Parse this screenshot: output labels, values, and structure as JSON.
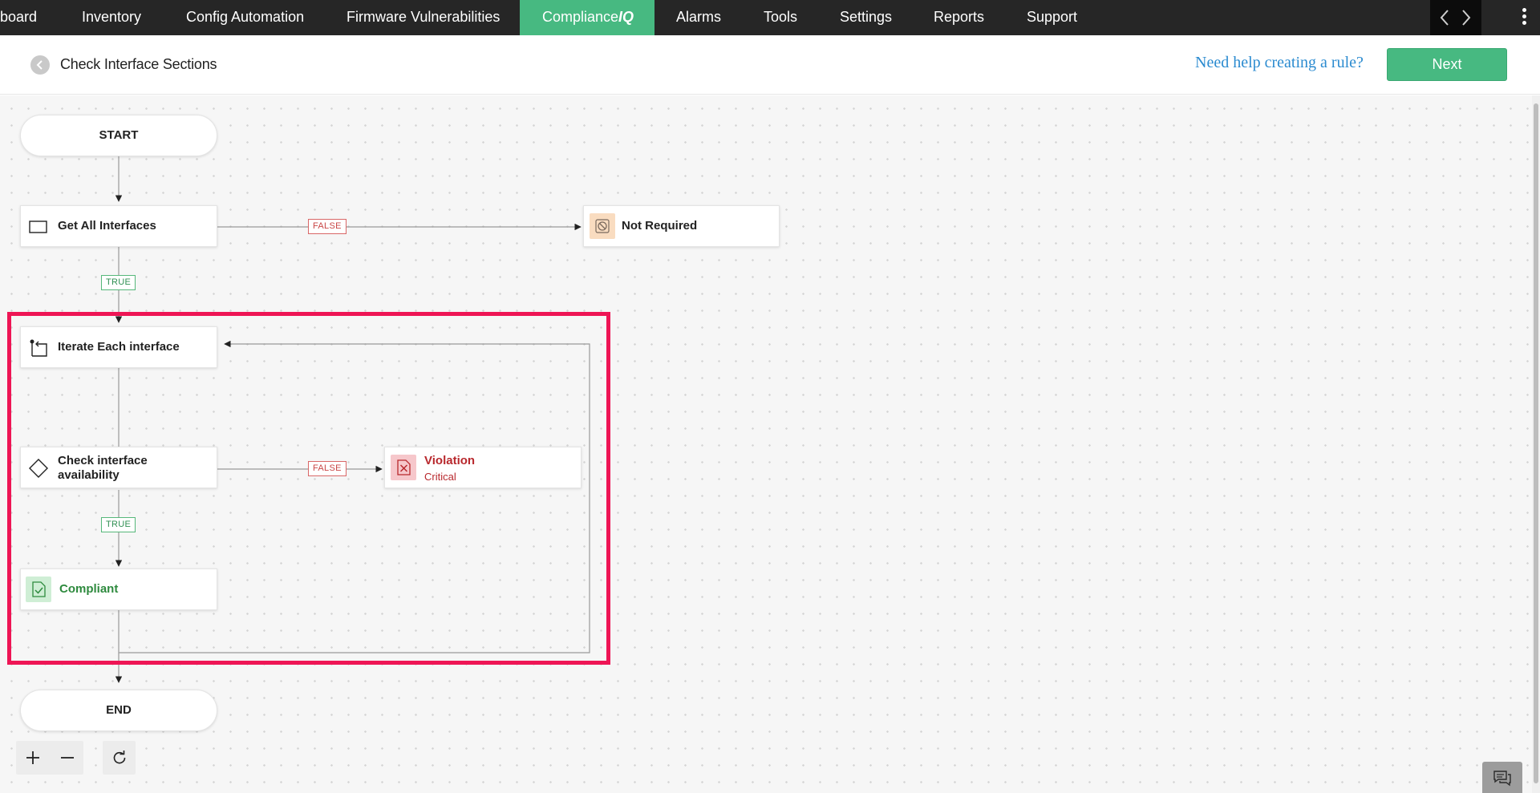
{
  "nav": {
    "items": [
      "board",
      "Inventory",
      "Config Automation",
      "Firmware Vulnerabilities",
      "Compliance",
      "Alarms",
      "Tools",
      "Settings",
      "Reports",
      "Support"
    ],
    "active_suffix": "IQ",
    "active_index": 4
  },
  "header": {
    "title": "Check Interface Sections",
    "help_link": "Need help creating a rule?",
    "next_label": "Next"
  },
  "flow": {
    "start_label": "START",
    "end_label": "END",
    "get_all_interfaces": "Get All Interfaces",
    "not_required": "Not Required",
    "iterate": "Iterate Each interface",
    "check_line1": "Check interface",
    "check_line2": "availability",
    "violation_title": "Violation",
    "violation_severity": "Critical",
    "compliant": "Compliant",
    "false_label": "FALSE",
    "true_label": "TRUE"
  },
  "colors": {
    "nav_bg": "#262626",
    "accent": "#47b981",
    "link": "#2b8bd0",
    "violation": "#b8282d",
    "compliant": "#2e8a3e",
    "highlight": "#ee1555"
  },
  "icons": {
    "back": "chevron-left-icon",
    "prev": "chevron-left-icon",
    "next": "chevron-right-icon",
    "menu": "kebab-menu-icon",
    "get_all": "rectangle-icon",
    "not_required": "blocked-icon",
    "iterate": "loop-icon",
    "condition": "diamond-icon",
    "violation": "x-document-icon",
    "compliant": "check-document-icon",
    "zoom_in": "plus-icon",
    "zoom_out": "minus-icon",
    "reset": "refresh-icon",
    "chat": "chat-icon"
  }
}
